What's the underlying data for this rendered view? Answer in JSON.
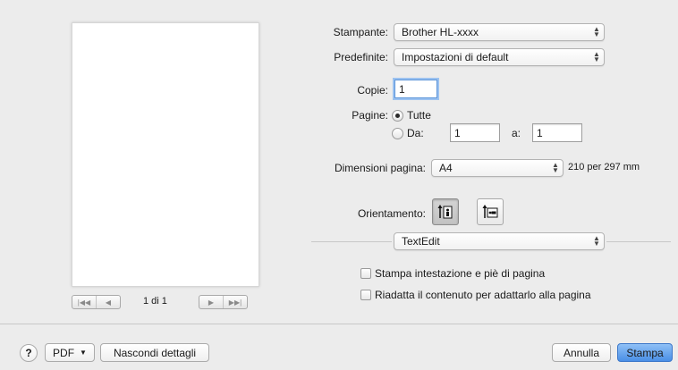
{
  "preview": {
    "page_info": "1 di 1"
  },
  "printer": {
    "label": "Stampante:",
    "value": "Brother HL-xxxx"
  },
  "presets": {
    "label": "Predefinite:",
    "value": "Impostazioni di default"
  },
  "copies": {
    "label": "Copie:",
    "value": "1"
  },
  "pages": {
    "label": "Pagine:",
    "all_label": "Tutte",
    "from_label": "Da:",
    "from_value": "1",
    "to_label": "a:",
    "to_value": "1",
    "selected": "all"
  },
  "paper_size": {
    "label": "Dimensioni pagina:",
    "value": "A4",
    "dimensions": "210 per 297 mm"
  },
  "orientation": {
    "label": "Orientamento:",
    "selected": "portrait"
  },
  "section_popup": {
    "value": "TextEdit"
  },
  "options": [
    {
      "label": "Stampa intestazione e piè di pagina",
      "checked": false
    },
    {
      "label": "Riadatta il contenuto per adattarlo alla pagina",
      "checked": false
    }
  ],
  "footer": {
    "help_label": "?",
    "pdf_label": "PDF",
    "hide_details_label": "Nascondi dettagli",
    "cancel_label": "Annulla",
    "print_label": "Stampa"
  },
  "colors": {
    "background": "#ececec",
    "accent": "#4a8fe6",
    "focus_ring": "#9cc2f0"
  }
}
